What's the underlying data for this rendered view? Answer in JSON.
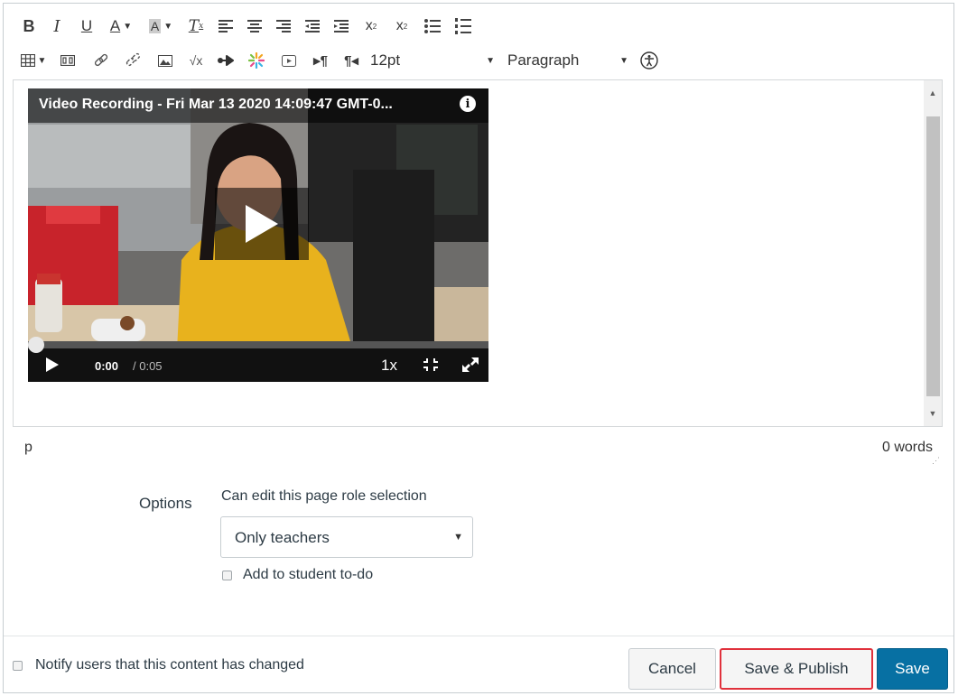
{
  "toolbar": {
    "row1": [
      {
        "name": "bold-button",
        "glyph": "B"
      },
      {
        "name": "italic-button",
        "glyph": "I"
      },
      {
        "name": "underline-button",
        "glyph": "U"
      },
      {
        "name": "text-color-button",
        "glyph": "A"
      },
      {
        "name": "background-color-button",
        "glyph": "A"
      },
      {
        "name": "clear-formatting-button",
        "glyph": "T"
      },
      {
        "name": "align-left-button",
        "glyph": ""
      },
      {
        "name": "align-center-button",
        "glyph": ""
      },
      {
        "name": "align-right-button",
        "glyph": ""
      },
      {
        "name": "indent-button",
        "glyph": ""
      },
      {
        "name": "outdent-button",
        "glyph": ""
      },
      {
        "name": "superscript-button",
        "glyph": "x²"
      },
      {
        "name": "subscript-button",
        "glyph": "x₂"
      },
      {
        "name": "bullet-list-button",
        "glyph": ""
      },
      {
        "name": "numbered-list-button",
        "glyph": ""
      }
    ],
    "font_size": "12pt",
    "block_format": "Paragraph"
  },
  "video": {
    "title": "Video Recording - Fri Mar 13 2020 14:09:47 GMT-0...",
    "current_time": "0:00",
    "duration": "/ 0:05",
    "speed": "1x",
    "progress": 0
  },
  "status": {
    "path": "p",
    "word_count": "0 words"
  },
  "options": {
    "label": "Options",
    "role_caption": "Can edit this page role selection",
    "role_value": "Only teachers",
    "todo_label": "Add to student to-do"
  },
  "footer": {
    "notify_label": "Notify users that this content has changed",
    "cancel_label": "Cancel",
    "publish_label": "Save & Publish",
    "save_label": "Save"
  },
  "colors": {
    "save_button": "#0770a3",
    "publish_highlight": "#e0313c"
  }
}
